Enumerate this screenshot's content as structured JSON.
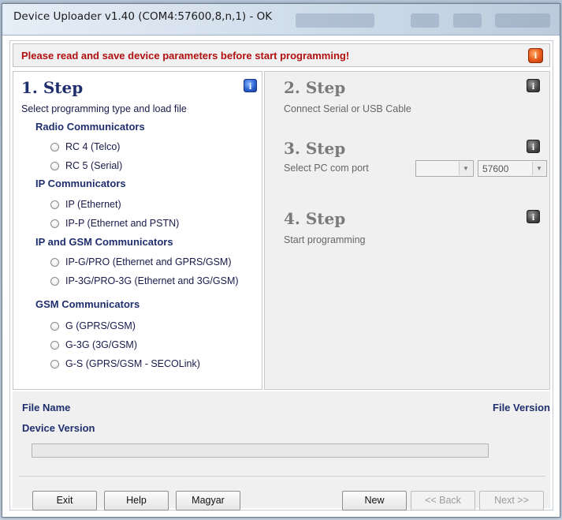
{
  "window": {
    "title": "Device Uploader v1.40 (COM4:57600,8,n,1) - OK"
  },
  "warning": {
    "text": "Please read and save device parameters before start programming!",
    "icon": "warning-icon"
  },
  "step1": {
    "title": "1. Step",
    "description": "Select programming type and load file",
    "groups": [
      {
        "title": "Radio Communicators",
        "options": [
          "RC 4 (Telco)",
          "RC 5 (Serial)"
        ]
      },
      {
        "title": "IP Communicators",
        "options": [
          "IP (Ethernet)",
          "IP-P (Ethernet and PSTN)"
        ]
      },
      {
        "title": "IP and GSM Communicators",
        "options": [
          "IP-G/PRO (Ethernet and GPRS/GSM)",
          "IP-3G/PRO-3G (Ethernet and 3G/GSM)"
        ]
      },
      {
        "title": "GSM Communicators",
        "options": [
          "G (GPRS/GSM)",
          "G-3G (3G/GSM)",
          "G-S (GPRS/GSM - SECOLink)"
        ]
      }
    ]
  },
  "step2": {
    "title": "2. Step",
    "description": "Connect Serial or USB Cable"
  },
  "step3": {
    "title": "3. Step",
    "description": "Select PC com port",
    "port_value": "",
    "baud_value": "57600"
  },
  "step4": {
    "title": "4. Step",
    "description": "Start programming"
  },
  "file_info": {
    "file_name_label": "File Name",
    "file_version_label": "File Version",
    "device_version_label": "Device Version",
    "progress": 0
  },
  "buttons": {
    "exit": "Exit",
    "help": "Help",
    "language": "Magyar",
    "new": "New",
    "back": "<< Back",
    "next": "Next >>"
  }
}
